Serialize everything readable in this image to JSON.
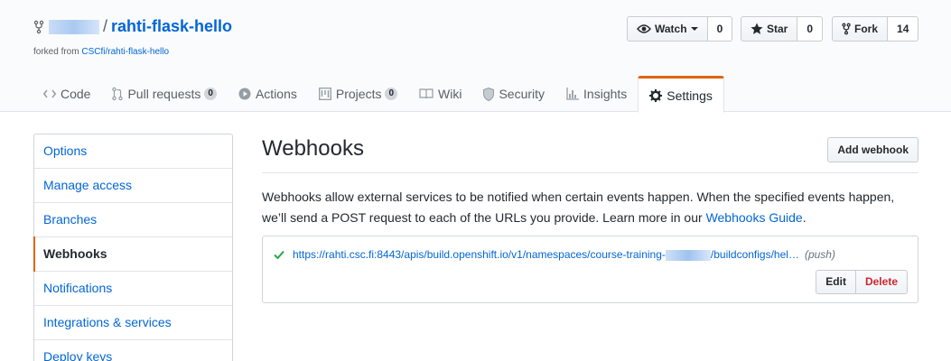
{
  "repo": {
    "name": "rahti-flask-hello",
    "slash": "/",
    "forked_label": "forked from",
    "forked_source": "CSCfi/rahti-flask-hello"
  },
  "actions": {
    "watch": {
      "label": "Watch",
      "count": "0"
    },
    "star": {
      "label": "Star",
      "count": "0"
    },
    "fork": {
      "label": "Fork",
      "count": "14"
    }
  },
  "tabs": [
    {
      "label": "Code",
      "icon": "code-icon"
    },
    {
      "label": "Pull requests",
      "icon": "pull-request-icon",
      "count": "0"
    },
    {
      "label": "Actions",
      "icon": "play-icon"
    },
    {
      "label": "Projects",
      "icon": "project-icon",
      "count": "0"
    },
    {
      "label": "Wiki",
      "icon": "book-icon"
    },
    {
      "label": "Security",
      "icon": "shield-icon"
    },
    {
      "label": "Insights",
      "icon": "graph-icon"
    },
    {
      "label": "Settings",
      "icon": "gear-icon",
      "selected": true
    }
  ],
  "sidebar": {
    "items": [
      {
        "label": "Options"
      },
      {
        "label": "Manage access"
      },
      {
        "label": "Branches"
      },
      {
        "label": "Webhooks",
        "selected": true
      },
      {
        "label": "Notifications"
      },
      {
        "label": "Integrations & services"
      },
      {
        "label": "Deploy keys"
      }
    ]
  },
  "main": {
    "title": "Webhooks",
    "add_button": "Add webhook",
    "description": "Webhooks allow external services to be notified when certain events happen. When the specified events happen, we’ll send a POST request to each of the URLs you provide. Learn more in our ",
    "guide_link": "Webhooks Guide",
    "description_end": ".",
    "hook": {
      "url_start": "https://rahti.csc.fi:8443/apis/build.openshift.io/v1/namespaces/course-training-",
      "url_end": "/buildconfigs/hel…",
      "event": "(push)",
      "edit_label": "Edit",
      "delete_label": "Delete"
    }
  },
  "colors": {
    "link": "#0366d6",
    "accent": "#e36209",
    "success": "#28a745",
    "danger": "#cb2431"
  }
}
